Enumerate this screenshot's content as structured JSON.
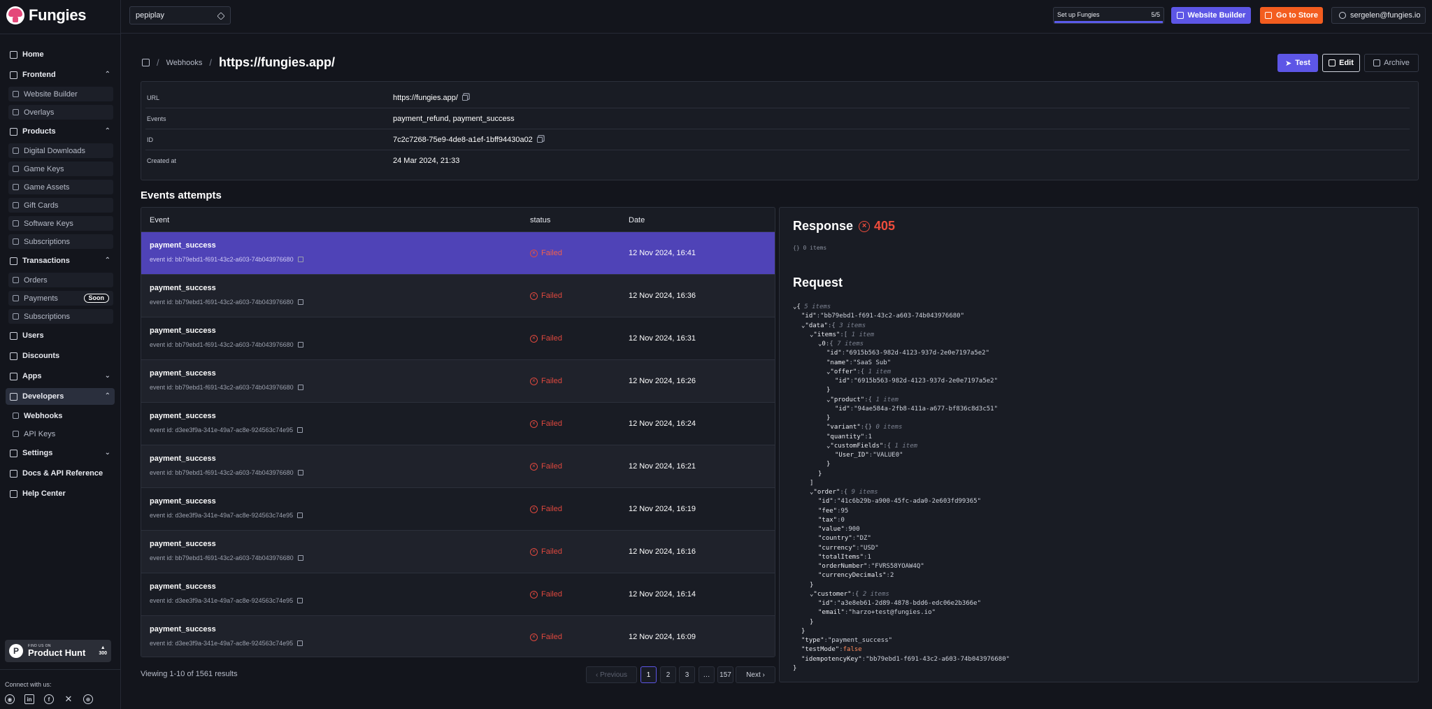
{
  "brand": {
    "name": "Fungies"
  },
  "sidebar": {
    "items": [
      {
        "label": "Home",
        "icon": "home-icon",
        "type": "top"
      },
      {
        "label": "Frontend",
        "icon": "frontend-icon",
        "type": "group",
        "chev": "⌃"
      },
      {
        "label": "Website Builder",
        "icon": "website-builder-icon",
        "type": "sub"
      },
      {
        "label": "Overlays",
        "icon": "overlays-icon",
        "type": "sub"
      },
      {
        "label": "Products",
        "icon": "products-icon",
        "type": "group",
        "chev": "⌃"
      },
      {
        "label": "Digital Downloads",
        "icon": "download-icon",
        "type": "sub"
      },
      {
        "label": "Game Keys",
        "icon": "key-icon",
        "type": "sub"
      },
      {
        "label": "Game Assets",
        "icon": "assets-icon",
        "type": "sub"
      },
      {
        "label": "Gift Cards",
        "icon": "gift-icon",
        "type": "sub"
      },
      {
        "label": "Software Keys",
        "icon": "software-key-icon",
        "type": "sub"
      },
      {
        "label": "Subscriptions",
        "icon": "subscriptions-icon",
        "type": "sub"
      },
      {
        "label": "Transactions",
        "icon": "transactions-icon",
        "type": "group",
        "chev": "⌃"
      },
      {
        "label": "Orders",
        "icon": "orders-icon",
        "type": "sub"
      },
      {
        "label": "Payments",
        "icon": "payments-icon",
        "type": "sub",
        "badge": "Soon"
      },
      {
        "label": "Subscriptions",
        "icon": "subscriptions-icon",
        "type": "sub"
      },
      {
        "label": "Users",
        "icon": "users-icon",
        "type": "top"
      },
      {
        "label": "Discounts",
        "icon": "discounts-icon",
        "type": "top"
      },
      {
        "label": "Apps",
        "icon": "apps-icon",
        "type": "top",
        "chev": "⌄"
      },
      {
        "label": "Developers",
        "icon": "developers-icon",
        "type": "group",
        "chev": "⌃",
        "active": true
      },
      {
        "label": "Webhooks",
        "icon": "webhooks-icon",
        "type": "sub",
        "active": true
      },
      {
        "label": "API Keys",
        "icon": "api-keys-icon",
        "type": "sub",
        "plain": true
      },
      {
        "label": "Settings",
        "icon": "settings-icon",
        "type": "top",
        "chev": "⌄"
      },
      {
        "label": "Docs & API Reference",
        "icon": "docs-icon",
        "type": "top"
      },
      {
        "label": "Help Center",
        "icon": "help-icon",
        "type": "top"
      }
    ],
    "producthunt": {
      "small": "FIND US ON",
      "big": "Product Hunt",
      "votes": "300",
      "arrow": "▲"
    },
    "connect_label": "Connect with us:"
  },
  "topbar": {
    "store": "pepiplay",
    "setup_label": "Set up Fungies",
    "setup_count": "5/5",
    "setup_progress": 1.0,
    "website_builder": "Website Builder",
    "go_to_store": "Go to Store",
    "user_email": "sergelen@fungies.io"
  },
  "header": {
    "crumb": "Webhooks",
    "title": "https://fungies.app/",
    "test": "Test",
    "edit": "Edit",
    "archive": "Archive"
  },
  "details": [
    {
      "key": "URL",
      "value": "https://fungies.app/",
      "copy": true
    },
    {
      "key": "Events",
      "value": "payment_refund, payment_success",
      "copy": false
    },
    {
      "key": "ID",
      "value": "7c2c7268-75e9-4de8-a1ef-1bff94430a02",
      "copy": true
    },
    {
      "key": "Created at",
      "value": "24 Mar 2024, 21:33",
      "copy": false
    }
  ],
  "events": {
    "title": "Events attempts",
    "columns": {
      "event": "Event",
      "status": "status",
      "date": "Date"
    },
    "rows": [
      {
        "event": "payment_success",
        "event_id": "event id: bb79ebd1-f691-43c2-a603-74b043976680",
        "status": "Failed",
        "date": "12 Nov 2024, 16:41",
        "selected": true
      },
      {
        "event": "payment_success",
        "event_id": "event id: bb79ebd1-f691-43c2-a603-74b043976680",
        "status": "Failed",
        "date": "12 Nov 2024, 16:36"
      },
      {
        "event": "payment_success",
        "event_id": "event id: bb79ebd1-f691-43c2-a603-74b043976680",
        "status": "Failed",
        "date": "12 Nov 2024, 16:31"
      },
      {
        "event": "payment_success",
        "event_id": "event id: bb79ebd1-f691-43c2-a603-74b043976680",
        "status": "Failed",
        "date": "12 Nov 2024, 16:26"
      },
      {
        "event": "payment_success",
        "event_id": "event id: d3ee3f9a-341e-49a7-ac8e-924563c74e95",
        "status": "Failed",
        "date": "12 Nov 2024, 16:24"
      },
      {
        "event": "payment_success",
        "event_id": "event id: bb79ebd1-f691-43c2-a603-74b043976680",
        "status": "Failed",
        "date": "12 Nov 2024, 16:21"
      },
      {
        "event": "payment_success",
        "event_id": "event id: d3ee3f9a-341e-49a7-ac8e-924563c74e95",
        "status": "Failed",
        "date": "12 Nov 2024, 16:19"
      },
      {
        "event": "payment_success",
        "event_id": "event id: bb79ebd1-f691-43c2-a603-74b043976680",
        "status": "Failed",
        "date": "12 Nov 2024, 16:16"
      },
      {
        "event": "payment_success",
        "event_id": "event id: d3ee3f9a-341e-49a7-ac8e-924563c74e95",
        "status": "Failed",
        "date": "12 Nov 2024, 16:14"
      },
      {
        "event": "payment_success",
        "event_id": "event id: d3ee3f9a-341e-49a7-ac8e-924563c74e95",
        "status": "Failed",
        "date": "12 Nov 2024, 16:09"
      }
    ],
    "viewing": "Viewing 1-10 of 1561 results",
    "pagination": {
      "previous": "‹ Previous",
      "pages": [
        "1",
        "2",
        "3",
        "…",
        "157"
      ],
      "next": "Next ›",
      "current": "1"
    }
  },
  "response": {
    "title": "Response",
    "code": "405",
    "body": "{} 0 items",
    "request_title": "Request"
  },
  "request_json": [
    [
      0,
      "⌄{ ",
      "",
      "",
      "5 items"
    ],
    [
      1,
      "\"id\"",
      ":",
      "\"bb79ebd1-f691-43c2-a603-74b043976680\"",
      ""
    ],
    [
      1,
      "⌄\"data\"",
      ":{ ",
      "",
      "3 items"
    ],
    [
      2,
      "⌄\"items\"",
      ":[ ",
      "",
      "1 item"
    ],
    [
      3,
      "⌄0",
      ":{ ",
      "",
      "7 items"
    ],
    [
      4,
      "\"id\"",
      ":",
      "\"6915b563-982d-4123-937d-2e0e7197a5e2\"",
      ""
    ],
    [
      4,
      "\"name\"",
      ":",
      "\"SaaS Sub\"",
      ""
    ],
    [
      4,
      "⌄\"offer\"",
      ":{ ",
      "",
      "1 item"
    ],
    [
      5,
      "\"id\"",
      ":",
      "\"6915b563-982d-4123-937d-2e0e7197a5e2\"",
      ""
    ],
    [
      4,
      "}",
      "",
      "",
      ""
    ],
    [
      4,
      "⌄\"product\"",
      ":{ ",
      "",
      "1 item"
    ],
    [
      5,
      "\"id\"",
      ":",
      "\"94ae584a-2fb8-411a-a677-bf836c8d3c51\"",
      ""
    ],
    [
      4,
      "}",
      "",
      "",
      ""
    ],
    [
      4,
      "\"variant\"",
      ":{} ",
      "",
      "0 items"
    ],
    [
      4,
      "\"quantity\"",
      ":",
      "1",
      ""
    ],
    [
      4,
      "⌄\"customFields\"",
      ":{ ",
      "",
      "1 item"
    ],
    [
      5,
      "\"User_ID\"",
      ":",
      "\"VALUE0\"",
      ""
    ],
    [
      4,
      "}",
      "",
      "",
      ""
    ],
    [
      3,
      "}",
      "",
      "",
      ""
    ],
    [
      2,
      "]",
      "",
      "",
      ""
    ],
    [
      2,
      "⌄\"order\"",
      ":{ ",
      "",
      "9 items"
    ],
    [
      3,
      "\"id\"",
      ":",
      "\"41c6b29b-a900-45fc-ada0-2e603fd99365\"",
      ""
    ],
    [
      3,
      "\"fee\"",
      ":",
      "95",
      ""
    ],
    [
      3,
      "\"tax\"",
      ":",
      "0",
      ""
    ],
    [
      3,
      "\"value\"",
      ":",
      "900",
      ""
    ],
    [
      3,
      "\"country\"",
      ":",
      "\"DZ\"",
      ""
    ],
    [
      3,
      "\"currency\"",
      ":",
      "\"USD\"",
      ""
    ],
    [
      3,
      "\"totalItems\"",
      ":",
      "1",
      ""
    ],
    [
      3,
      "\"orderNumber\"",
      ":",
      "\"FVRS58YOAW4Q\"",
      ""
    ],
    [
      3,
      "\"currencyDecimals\"",
      ":",
      "2",
      ""
    ],
    [
      2,
      "}",
      "",
      "",
      ""
    ],
    [
      2,
      "⌄\"customer\"",
      ":{ ",
      "",
      "2 items"
    ],
    [
      3,
      "\"id\"",
      ":",
      "\"a3e8eb61-2d89-4878-bdd6-edc06e2b366e\"",
      ""
    ],
    [
      3,
      "\"email\"",
      ":",
      "\"harzo+test@fungies.io\"",
      ""
    ],
    [
      2,
      "}",
      "",
      "",
      ""
    ],
    [
      1,
      "}",
      "",
      "",
      ""
    ],
    [
      1,
      "\"type\"",
      ":",
      "\"payment_success\"",
      ""
    ],
    [
      1,
      "\"testMode\"",
      ":",
      "false",
      ""
    ],
    [
      1,
      "\"idempotencyKey\"",
      ":",
      "\"bb79ebd1-f691-43c2-a603-74b043976680\"",
      ""
    ],
    [
      0,
      "}",
      "",
      "",
      ""
    ]
  ]
}
